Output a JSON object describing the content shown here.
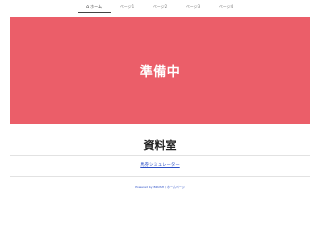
{
  "nav": {
    "items": [
      {
        "icon": "home-icon",
        "label": "ホーム",
        "active": true
      },
      {
        "label": "ページ1"
      },
      {
        "label": "ページ2"
      },
      {
        "label": "ページ3"
      },
      {
        "label": "ページ4"
      }
    ]
  },
  "hero": {
    "title": "準備中",
    "background_color": "#eb5e69"
  },
  "main": {
    "heading": "資料室",
    "link_label": "馬券シミュレーター"
  },
  "footer": {
    "text": "Powered by BRUSH / ホームページ"
  }
}
